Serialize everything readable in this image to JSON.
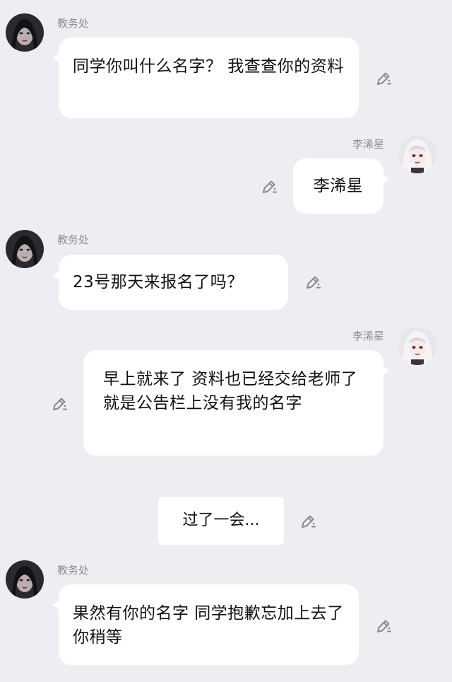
{
  "colors": {
    "background": "#ededf2",
    "bubble": "#ffffff",
    "sender_text": "#8e8e93",
    "icon": "#8a8a8e"
  },
  "messages": [
    {
      "sender": "教务处",
      "text": "同学你叫什么名字？ 我查查你的资料",
      "side": "left",
      "icon": "pencil-edit-icon"
    },
    {
      "sender": "李浠星",
      "text": "李浠星",
      "side": "right",
      "icon": "pencil-edit-icon"
    },
    {
      "sender": "教务处",
      "text": "23号那天来报名了吗？",
      "side": "left",
      "icon": "pencil-edit-icon"
    },
    {
      "sender": "李浠星",
      "text": "早上就来了 资料也已经交给老师了 就是公告栏上没有我的名字",
      "side": "right",
      "icon": "pencil-edit-icon"
    },
    {
      "sender": "",
      "text": "过了一会...",
      "side": "narration",
      "icon": "pencil-edit-icon"
    },
    {
      "sender": "教务处",
      "text": "果然有你的名字 同学抱歉忘加上去了 你稍等",
      "side": "left",
      "icon": "pencil-edit-icon"
    }
  ]
}
